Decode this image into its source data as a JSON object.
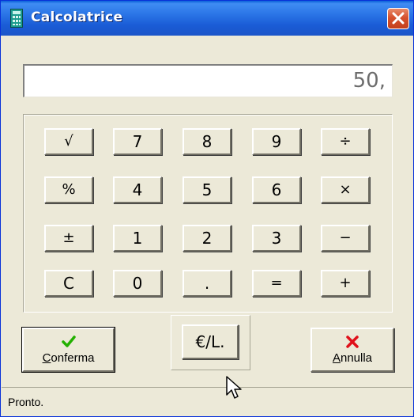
{
  "window": {
    "title": "Calcolatrice",
    "accent_color": "#2a74e6",
    "icon": "calculator-icon",
    "close_icon": "close-icon"
  },
  "display": {
    "value": "50,"
  },
  "keypad": {
    "rows": [
      [
        "√",
        "7",
        "8",
        "9",
        "÷"
      ],
      [
        "%",
        "4",
        "5",
        "6",
        "×"
      ],
      [
        "±",
        "1",
        "2",
        "3",
        "−"
      ],
      [
        "C",
        "0",
        ".",
        "=",
        "+"
      ]
    ]
  },
  "buttons": {
    "conferma": {
      "label_underlined": "C",
      "label_rest": "onferma",
      "icon": "check-icon",
      "icon_color": "#22b000"
    },
    "annulla": {
      "label_underlined": "A",
      "label_rest": "nnulla",
      "icon": "x-icon",
      "icon_color": "#e0101a"
    },
    "currency": {
      "label": "€/L."
    }
  },
  "status": {
    "text": "Pronto."
  }
}
